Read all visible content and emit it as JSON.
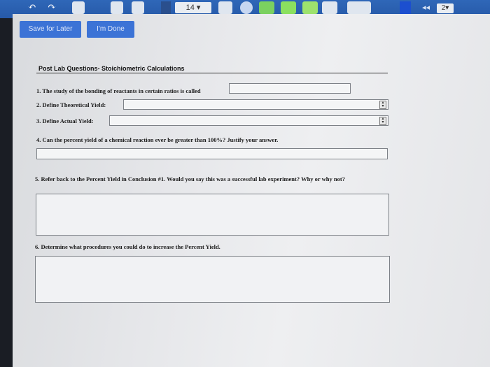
{
  "toolbar": {
    "font_size": "14",
    "page_number": "2",
    "icons": [
      "undo-icon",
      "redo-icon",
      "zoom-in-icon",
      "zoom-out-icon",
      "trash-icon",
      "text-color-icon",
      "font-size-select",
      "table-icon",
      "circle-icon",
      "check-icon",
      "pencil-icon",
      "highlighter-icon",
      "eraser-icon",
      "grid-icon",
      "color-swatch-icon",
      "arrow-back-icon",
      "page-select"
    ]
  },
  "buttons": {
    "save_label": "Save for Later",
    "done_label": "I'm Done"
  },
  "form": {
    "title": "Post Lab Questions- Stoichiometric Calculations",
    "q1": "1. The study of the bonding of reactants in certain ratios is called",
    "q2": "2. Define Theoretical Yield:",
    "q3": "3. Define Actual Yield:",
    "q4": "4. Can the percent yield of a chemical reaction ever be greater than 100%? Justify your answer.",
    "q5": "5. Refer back to the Percent Yield in Conclusion #1. Would you say this was a successful lab experiment? Why or why not?",
    "q6": "6. Determine what procedures you could do to increase the Percent Yield."
  }
}
